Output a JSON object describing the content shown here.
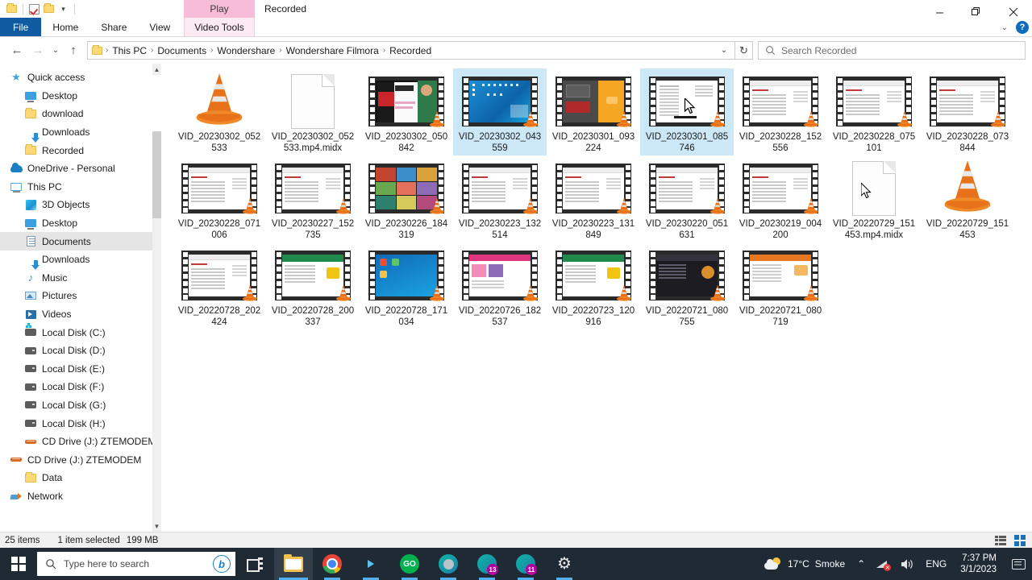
{
  "window": {
    "title": "Recorded",
    "contextual_tab": "Play",
    "contextual_group": "Video Tools",
    "quick_access": [
      "folder-icon",
      "properties-icon",
      "new-folder-icon",
      "customize-caret"
    ],
    "controls": {
      "minimize": "minimize-button",
      "maximize": "restore-button",
      "close": "close-button"
    }
  },
  "ribbon": {
    "tabs": [
      "File",
      "Home",
      "Share",
      "View"
    ],
    "help_label": "?",
    "collapse_label": "⌄"
  },
  "address": {
    "back": "←",
    "forward": "→",
    "recent": "⌄",
    "up": "↑",
    "breadcrumbs": [
      "This PC",
      "Documents",
      "Wondershare",
      "Wondershare Filmora",
      "Recorded"
    ],
    "separator": "›",
    "dropdown": "⌄",
    "refresh": "↻"
  },
  "search": {
    "placeholder": "Search Recorded",
    "value": "",
    "icon": "search-icon"
  },
  "sidebar": {
    "items": [
      {
        "label": "Quick access",
        "icon": "star-icon",
        "indent": 0,
        "selected": false
      },
      {
        "label": "Desktop",
        "icon": "monitor-icon",
        "indent": 1,
        "selected": false
      },
      {
        "label": "download",
        "icon": "folder-icon",
        "indent": 1,
        "selected": false
      },
      {
        "label": "Downloads",
        "icon": "download-arrow-icon",
        "indent": 1,
        "selected": false
      },
      {
        "label": "Recorded",
        "icon": "folder-icon",
        "indent": 1,
        "selected": false
      },
      {
        "label": "OneDrive - Personal",
        "icon": "cloud-icon",
        "indent": 0,
        "selected": false
      },
      {
        "label": "This PC",
        "icon": "pc-icon",
        "indent": 0,
        "selected": false
      },
      {
        "label": "3D Objects",
        "icon": "3d-objects-icon",
        "indent": 1,
        "selected": false
      },
      {
        "label": "Desktop",
        "icon": "monitor-icon",
        "indent": 1,
        "selected": false
      },
      {
        "label": "Documents",
        "icon": "documents-icon",
        "indent": 1,
        "selected": true
      },
      {
        "label": "Downloads",
        "icon": "download-arrow-icon",
        "indent": 1,
        "selected": false
      },
      {
        "label": "Music",
        "icon": "music-note-icon",
        "indent": 1,
        "selected": false
      },
      {
        "label": "Pictures",
        "icon": "pictures-icon",
        "indent": 1,
        "selected": false
      },
      {
        "label": "Videos",
        "icon": "videos-icon",
        "indent": 1,
        "selected": false
      },
      {
        "label": "Local Disk (C:)",
        "icon": "system-disk-icon",
        "indent": 1,
        "selected": false
      },
      {
        "label": "Local Disk (D:)",
        "icon": "disk-icon",
        "indent": 1,
        "selected": false
      },
      {
        "label": "Local Disk (E:)",
        "icon": "disk-icon",
        "indent": 1,
        "selected": false
      },
      {
        "label": "Local Disk  (F:)",
        "icon": "disk-icon",
        "indent": 1,
        "selected": false
      },
      {
        "label": "Local Disk (G:)",
        "icon": "disk-icon",
        "indent": 1,
        "selected": false
      },
      {
        "label": "Local Disk  (H:)",
        "icon": "disk-icon",
        "indent": 1,
        "selected": false
      },
      {
        "label": "CD Drive (J:) ZTEMODEM",
        "icon": "cd-drive-icon",
        "indent": 1,
        "selected": false
      },
      {
        "label": "CD Drive (J:) ZTEMODEM",
        "icon": "cd-drive-icon",
        "indent": 0,
        "selected": false
      },
      {
        "label": "Data",
        "icon": "folder-icon",
        "indent": 1,
        "selected": false
      },
      {
        "label": "Network",
        "icon": "network-icon",
        "indent": 0,
        "selected": false
      }
    ]
  },
  "files": [
    {
      "name": "VID_20230302_052533",
      "kind": "vlc",
      "selected": false
    },
    {
      "name": "VID_20230302_052533.mp4.midx",
      "kind": "doc",
      "selected": false
    },
    {
      "name": "VID_20230302_050842",
      "kind": "video",
      "selected": false,
      "shot": "news"
    },
    {
      "name": "VID_20230302_043559",
      "kind": "video",
      "selected": true,
      "shot": "desktop"
    },
    {
      "name": "VID_20230301_093224",
      "kind": "video",
      "selected": false,
      "shot": "darkorange"
    },
    {
      "name": "VID_20230301_085746",
      "kind": "video",
      "selected": true,
      "shot": "whitedoc"
    },
    {
      "name": "VID_20230228_152556",
      "kind": "video",
      "selected": false,
      "shot": "webpage"
    },
    {
      "name": "VID_20230228_075101",
      "kind": "video",
      "selected": false,
      "shot": "webpage"
    },
    {
      "name": "VID_20230228_073844",
      "kind": "video",
      "selected": false,
      "shot": "webpage"
    },
    {
      "name": "VID_20230228_071006",
      "kind": "video",
      "selected": false,
      "shot": "webpage"
    },
    {
      "name": "VID_20230227_152735",
      "kind": "video",
      "selected": false,
      "shot": "webpage"
    },
    {
      "name": "VID_20230226_184319",
      "kind": "video",
      "selected": false,
      "shot": "collage"
    },
    {
      "name": "VID_20230223_132514",
      "kind": "video",
      "selected": false,
      "shot": "webpage"
    },
    {
      "name": "VID_20230223_131849",
      "kind": "video",
      "selected": false,
      "shot": "webpage"
    },
    {
      "name": "VID_20230220_051631",
      "kind": "video",
      "selected": false,
      "shot": "webpage"
    },
    {
      "name": "VID_20230219_004200",
      "kind": "video",
      "selected": false,
      "shot": "webpage"
    },
    {
      "name": "VID_20220729_151453.mp4.midx",
      "kind": "doc",
      "selected": false
    },
    {
      "name": "VID_20220729_151453",
      "kind": "vlc",
      "selected": false
    },
    {
      "name": "VID_20220728_202424",
      "kind": "video",
      "selected": false,
      "shot": "webpage"
    },
    {
      "name": "VID_20220728_200337",
      "kind": "video",
      "selected": false,
      "shot": "greenweb"
    },
    {
      "name": "VID_20220728_171034",
      "kind": "video",
      "selected": false,
      "shot": "bluedesk"
    },
    {
      "name": "VID_20220726_182537",
      "kind": "video",
      "selected": false,
      "shot": "pinkweb"
    },
    {
      "name": "VID_20220723_120916",
      "kind": "video",
      "selected": false,
      "shot": "greenweb"
    },
    {
      "name": "VID_20220721_080755",
      "kind": "video",
      "selected": false,
      "shot": "darkweb"
    },
    {
      "name": "VID_20220721_080719",
      "kind": "video",
      "selected": false,
      "shot": "orangeweb"
    }
  ],
  "status": {
    "item_count": "25 items",
    "selection": "1 item selected",
    "size": "199 MB",
    "view_details": "details-view-button",
    "view_thumbnails": "thumbnails-view-button"
  },
  "taskbar": {
    "start": "start-button",
    "search_placeholder": "Type here to search",
    "bing_label": "b",
    "apps": [
      {
        "name": "task-view",
        "running": false
      },
      {
        "name": "file-explorer",
        "running": true,
        "active": true
      },
      {
        "name": "google-chrome",
        "running": true
      },
      {
        "name": "terminal",
        "running": true
      },
      {
        "name": "grab-app",
        "running": true
      },
      {
        "name": "teams-app",
        "running": true,
        "badge": ""
      },
      {
        "name": "teams-app-2",
        "running": true,
        "badge": "13"
      },
      {
        "name": "teams-app-3",
        "running": true,
        "badge": "11"
      },
      {
        "name": "settings",
        "running": true
      }
    ],
    "weather": {
      "temperature": "17°C",
      "condition": "Smoke"
    },
    "tray": {
      "overflow": "⌃",
      "network": "network-disconnected-icon",
      "volume": "volume-icon",
      "language": "ENG"
    },
    "clock": {
      "time": "7:37 PM",
      "date": "3/1/2023"
    },
    "notifications": "notification-center-icon"
  }
}
